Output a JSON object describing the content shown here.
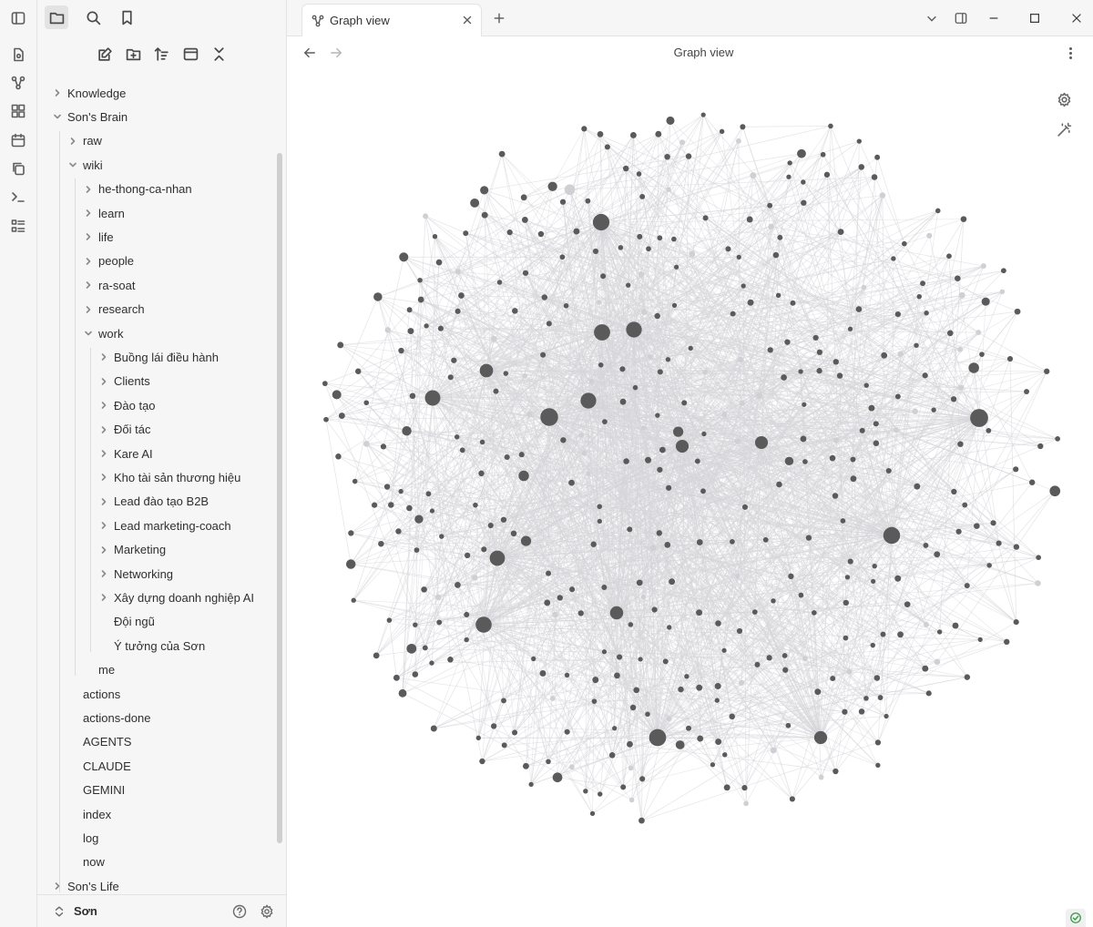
{
  "tab": {
    "title": "Graph view"
  },
  "view": {
    "title": "Graph view"
  },
  "vault": {
    "name": "Sơn"
  },
  "tree": [
    {
      "label": "Knowledge",
      "level": 0,
      "chevron": "right"
    },
    {
      "label": "Son's Brain",
      "level": 0,
      "chevron": "down"
    },
    {
      "label": "raw",
      "level": 1,
      "chevron": "right"
    },
    {
      "label": "wiki",
      "level": 1,
      "chevron": "down"
    },
    {
      "label": "he-thong-ca-nhan",
      "level": 2,
      "chevron": "right"
    },
    {
      "label": "learn",
      "level": 2,
      "chevron": "right"
    },
    {
      "label": "life",
      "level": 2,
      "chevron": "right"
    },
    {
      "label": "people",
      "level": 2,
      "chevron": "right"
    },
    {
      "label": "ra-soat",
      "level": 2,
      "chevron": "right"
    },
    {
      "label": "research",
      "level": 2,
      "chevron": "right"
    },
    {
      "label": "work",
      "level": 2,
      "chevron": "down"
    },
    {
      "label": "Buồng lái điều hành",
      "level": 3,
      "chevron": "right"
    },
    {
      "label": "Clients",
      "level": 3,
      "chevron": "right"
    },
    {
      "label": "Đào tạo",
      "level": 3,
      "chevron": "right"
    },
    {
      "label": "Đối tác",
      "level": 3,
      "chevron": "right"
    },
    {
      "label": "Kare AI",
      "level": 3,
      "chevron": "right"
    },
    {
      "label": "Kho tài sản thương hiệu",
      "level": 3,
      "chevron": "right"
    },
    {
      "label": "Lead đào tạo B2B",
      "level": 3,
      "chevron": "right"
    },
    {
      "label": "Lead marketing-coach",
      "level": 3,
      "chevron": "right"
    },
    {
      "label": "Marketing",
      "level": 3,
      "chevron": "right"
    },
    {
      "label": "Networking",
      "level": 3,
      "chevron": "right"
    },
    {
      "label": "Xây dựng doanh nghiệp AI",
      "level": 3,
      "chevron": "right"
    },
    {
      "label": "Đội ngũ",
      "level": 3,
      "chevron": "none"
    },
    {
      "label": "Ý tưởng của Sơn",
      "level": 3,
      "chevron": "none"
    },
    {
      "label": "me",
      "level": 2,
      "chevron": "none"
    },
    {
      "label": "actions",
      "level": 1,
      "chevron": "none"
    },
    {
      "label": "actions-done",
      "level": 1,
      "chevron": "none"
    },
    {
      "label": "AGENTS",
      "level": 1,
      "chevron": "none"
    },
    {
      "label": "CLAUDE",
      "level": 1,
      "chevron": "none"
    },
    {
      "label": "GEMINI",
      "level": 1,
      "chevron": "none"
    },
    {
      "label": "index",
      "level": 1,
      "chevron": "none"
    },
    {
      "label": "log",
      "level": 1,
      "chevron": "none"
    },
    {
      "label": "now",
      "level": 1,
      "chevron": "none"
    },
    {
      "label": "Son's Life",
      "level": 0,
      "chevron": "right"
    }
  ],
  "colors": {
    "node": "#5a5a5a",
    "node_faint": "#cfcfd4",
    "edge": "#d4d4d9",
    "accent": "#3a7bd5"
  }
}
